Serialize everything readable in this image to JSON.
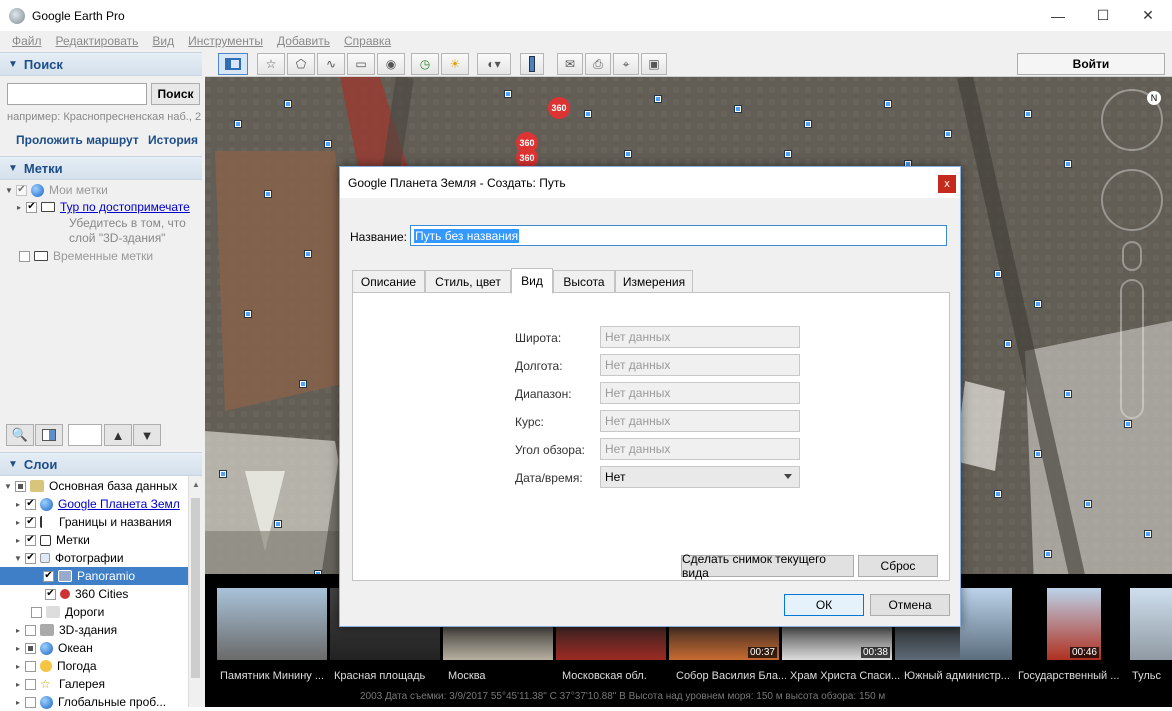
{
  "window": {
    "title": "Google Earth Pro",
    "minimize": "—",
    "maximize": "☐",
    "close": "✕"
  },
  "menu": [
    "Файл",
    "Редактировать",
    "Вид",
    "Инструменты",
    "Добавить",
    "Справка"
  ],
  "search": {
    "header": "Поиск",
    "placeholder": "",
    "button": "Поиск",
    "hint": "например: Краснопресненская наб., 2",
    "route_link": "Проложить маршрут",
    "history_link": "История"
  },
  "places": {
    "header": "Метки",
    "items": [
      {
        "label": "Мои метки"
      },
      {
        "label": "Тур по достопримечате",
        "desc1": "Убедитесь в том, что",
        "desc2": "слой \"3D-здания\""
      },
      {
        "label": "Временные метки"
      }
    ]
  },
  "layers": {
    "header": "Слои",
    "items": [
      {
        "label": "Основная база данных"
      },
      {
        "label": "Google Планета Земл"
      },
      {
        "label": "Границы и названия"
      },
      {
        "label": "Метки"
      },
      {
        "label": "Фотографии"
      },
      {
        "label": "Panoramio"
      },
      {
        "label": "360 Cities"
      },
      {
        "label": "Дороги"
      },
      {
        "label": "3D-здания"
      },
      {
        "label": "Океан"
      },
      {
        "label": "Погода"
      },
      {
        "label": "Галерея"
      },
      {
        "label": "Глобальные проб..."
      }
    ]
  },
  "toolbar": {
    "login": "Войти"
  },
  "map": {
    "badge": "360"
  },
  "dialog": {
    "title": "Google Планета Земля - Создать: Путь",
    "close": "x",
    "name_label": "Название:",
    "name_value": "Путь без названия",
    "tabs": [
      "Описание",
      "Стиль, цвет",
      "Вид",
      "Высота",
      "Измерения"
    ],
    "active_tab": "Вид",
    "fields": [
      {
        "label": "Широта:",
        "placeholder": "Нет данных"
      },
      {
        "label": "Долгота:",
        "placeholder": "Нет данных"
      },
      {
        "label": "Диапазон:",
        "placeholder": "Нет данных"
      },
      {
        "label": "Курс:",
        "placeholder": "Нет данных"
      },
      {
        "label": "Угол обзора:",
        "placeholder": "Нет данных"
      }
    ],
    "datetime_label": "Дата/время:",
    "datetime_value": "Нет",
    "snapshot_button": "Сделать снимок текущего вида",
    "reset_button": "Сброс",
    "ok_button": "ОК",
    "cancel_button": "Отмена"
  },
  "strip": {
    "captions": [
      "Памятник Минину ...",
      "Красная площадь",
      "Москва",
      "Московская обл.",
      "Собор Василия Бла...",
      "Храм Христа Спаси...",
      "Южный администр...",
      "Государственный ...",
      "Тульс"
    ],
    "durations": [
      "00:37",
      "00:38",
      "00:46"
    ]
  },
  "status": "2003        Дата съемки: 3/9/2017    55°45'11.38\" С  37°37'10.88\" В  Высота над уровнем моря: 150 м  высота обзора: 150 м"
}
